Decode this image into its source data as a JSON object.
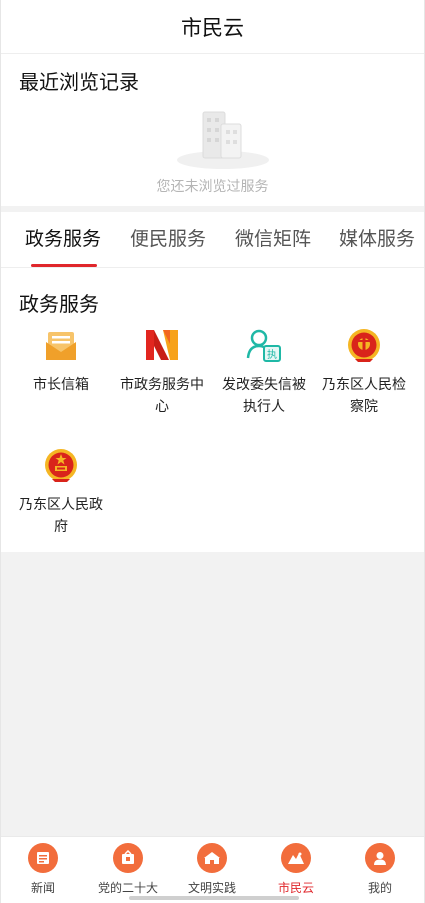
{
  "header": {
    "title": "市民云"
  },
  "recent": {
    "title": "最近浏览记录",
    "empty_text": "您还未浏览过服务"
  },
  "tabs": [
    {
      "label": "政务服务",
      "active": true
    },
    {
      "label": "便民服务",
      "active": false
    },
    {
      "label": "微信矩阵",
      "active": false
    },
    {
      "label": "媒体服务",
      "active": false
    }
  ],
  "services": {
    "title": "政务服务",
    "items": [
      {
        "label": "市长信箱",
        "icon": "mailbox-icon"
      },
      {
        "label": "市政务服务中心",
        "icon": "gov-service-center-logo"
      },
      {
        "label": "发改委失信被执行人",
        "icon": "person-enforcement-icon"
      },
      {
        "label": "乃东区人民检察院",
        "icon": "procuratorate-emblem"
      },
      {
        "label": "乃东区人民政府",
        "icon": "national-emblem"
      }
    ]
  },
  "bottom_nav": [
    {
      "label": "新闻",
      "icon": "news-icon",
      "active": false
    },
    {
      "label": "党的二十大",
      "icon": "party-icon",
      "active": false
    },
    {
      "label": "文明实践",
      "icon": "civilization-icon",
      "active": false
    },
    {
      "label": "市民云",
      "icon": "citizen-cloud-icon",
      "active": true
    },
    {
      "label": "我的",
      "icon": "profile-icon",
      "active": false
    }
  ],
  "colors": {
    "accent": "#e0262b",
    "nav_icon": "#f26d3c",
    "mail": "#f0a02a",
    "teal": "#1fb8a6"
  }
}
